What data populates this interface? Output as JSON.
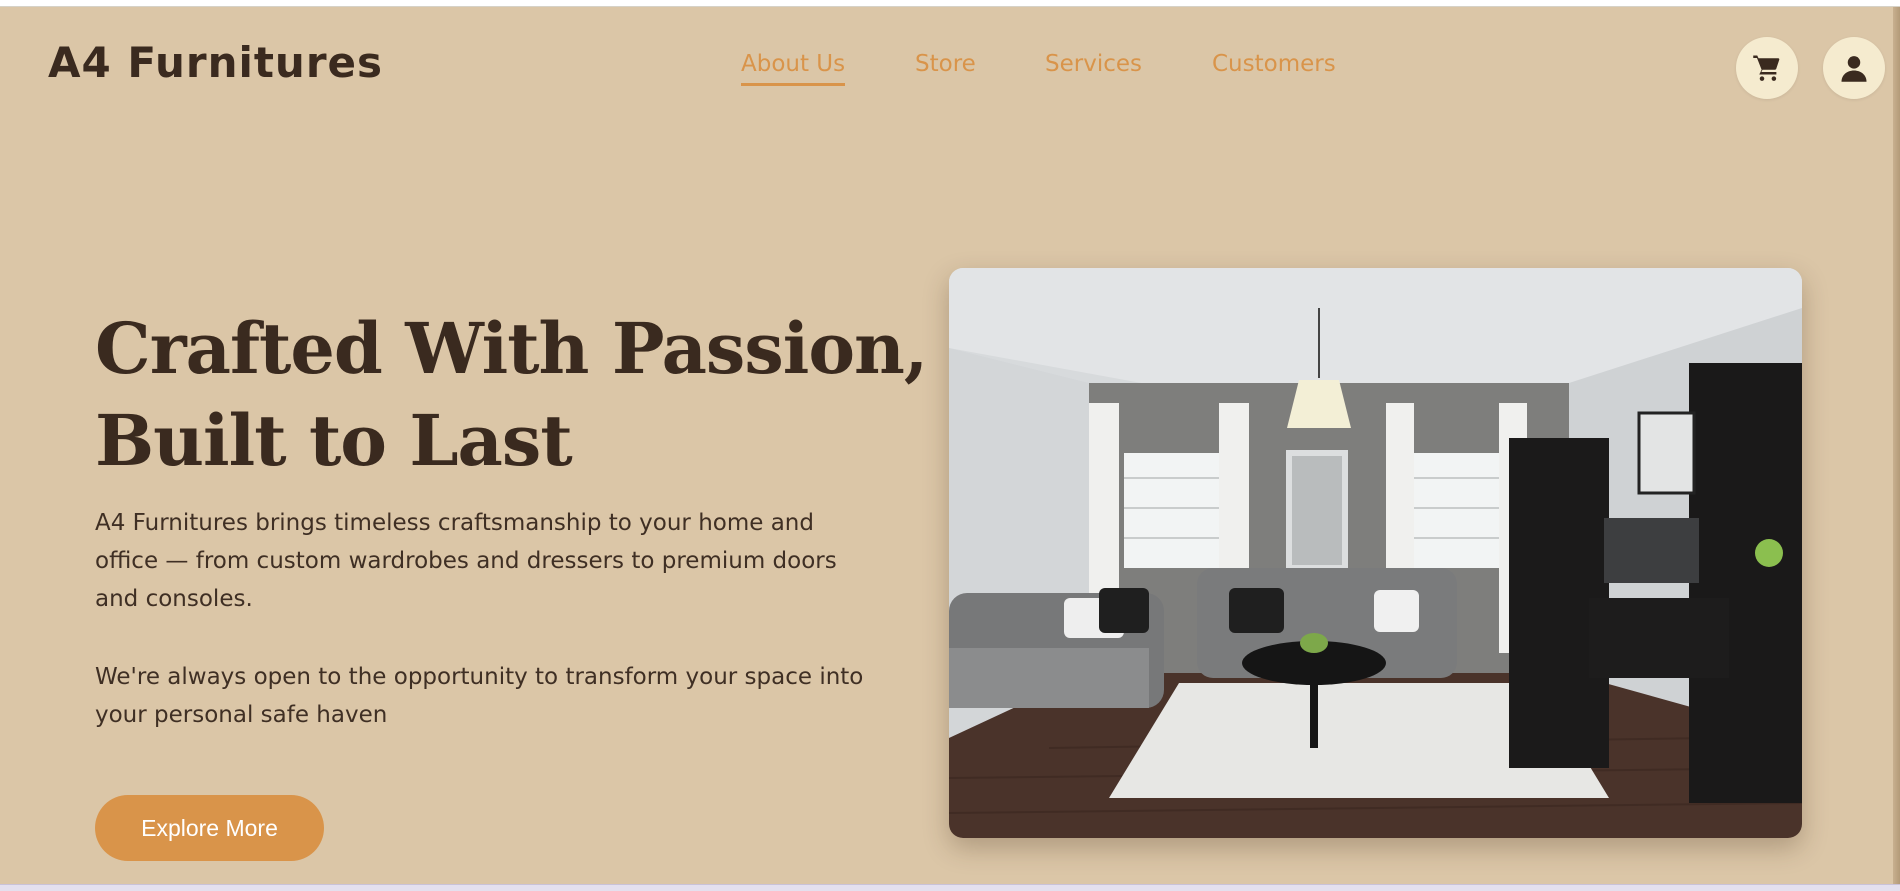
{
  "brand": {
    "name": "A4 Furnitures"
  },
  "nav": {
    "items": [
      {
        "label": "About Us",
        "active": true
      },
      {
        "label": "Store",
        "active": false
      },
      {
        "label": "Services",
        "active": false
      },
      {
        "label": "Customers",
        "active": false
      }
    ]
  },
  "header_actions": {
    "cart_icon": "cart-icon",
    "account_icon": "user-icon"
  },
  "hero": {
    "title": "Crafted With Passion, Built to Last",
    "paragraph_1": "A4 Furnitures brings timeless craftsmanship to your home and office — from custom wardrobes and dressers to premium doors and consoles.",
    "paragraph_2": "We're always open to the opportunity to transform your space into your personal safe haven",
    "cta_label": "Explore More",
    "image": "living-room-photo"
  },
  "colors": {
    "background": "#dbc6a7",
    "accent": "#d9944a",
    "text_dark": "#3a2a1f",
    "icon_button_bg": "#f5ebcf"
  }
}
